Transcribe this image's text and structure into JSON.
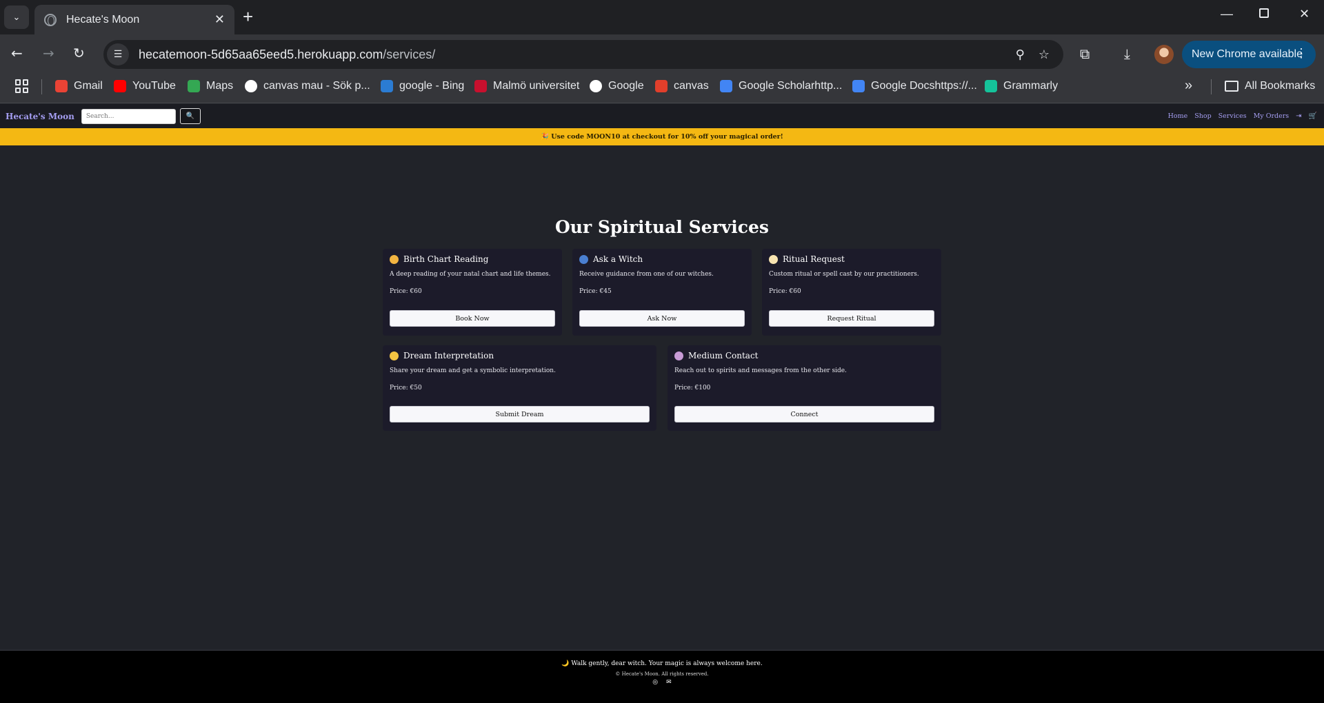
{
  "browser": {
    "tab_title": "Hecate's Moon",
    "tab_close": "✕",
    "new_tab": "+",
    "url_host": "hecatemoon-5d65aa65eed5.herokuapp.com",
    "url_path": "/services/",
    "update_button": "New Chrome available",
    "bookmarks": [
      {
        "label": "Gmail",
        "color": "#ea4335"
      },
      {
        "label": "YouTube",
        "color": "#ff0000"
      },
      {
        "label": "Maps",
        "color": "#34a853"
      },
      {
        "label": "canvas mau - Sök p...",
        "color": "#ffffff"
      },
      {
        "label": "google - Bing",
        "color": "#2b7cd3"
      },
      {
        "label": "Malmö universitet",
        "color": "#c8102e"
      },
      {
        "label": "Google",
        "color": "#ffffff"
      },
      {
        "label": "canvas",
        "color": "#e13f2b"
      },
      {
        "label": "Google Scholarhttp...",
        "color": "#4285f4"
      },
      {
        "label": "Google Docshttps://...",
        "color": "#4285f4"
      },
      {
        "label": "Grammarly",
        "color": "#15c39a"
      }
    ],
    "more_bookmarks": "»",
    "all_bookmarks": "All Bookmarks"
  },
  "site": {
    "brand": "Hecate's Moon",
    "search_placeholder": "Search...",
    "search_button_icon": "🔍",
    "nav": [
      "Home",
      "Shop",
      "Services",
      "My Orders"
    ],
    "logout_icon": "⇥",
    "cart_icon": "🛒",
    "promo": "🎉 Use code MOON10 at checkout for 10% off your magical order!"
  },
  "services": {
    "title": "Our Spiritual Services",
    "cards": [
      {
        "emoji_color": "#f2b441",
        "title": "Birth Chart Reading",
        "desc": "A deep reading of your natal chart and life themes.",
        "price": "Price: €60",
        "button": "Book Now"
      },
      {
        "emoji_color": "#4a7fd1",
        "title": "Ask a Witch",
        "desc": "Receive guidance from one of our witches.",
        "price": "Price: €45",
        "button": "Ask Now"
      },
      {
        "emoji_color": "#f7e3b0",
        "title": "Ritual Request",
        "desc": "Custom ritual or spell cast by our practitioners.",
        "price": "Price: €60",
        "button": "Request Ritual"
      },
      {
        "emoji_color": "#f4c542",
        "title": "Dream Interpretation",
        "desc": "Share your dream and get a symbolic interpretation.",
        "price": "Price: €50",
        "button": "Submit Dream"
      },
      {
        "emoji_color": "#c89bd6",
        "title": "Medium Contact",
        "desc": "Reach out to spirits and messages from the other side.",
        "price": "Price: €100",
        "button": "Connect"
      }
    ]
  },
  "footer": {
    "tagline": "🌙 Walk gently, dear witch. Your magic is always welcome here.",
    "copyright": "© Hecate's Moon. All rights reserved.",
    "instagram_icon": "◎",
    "email_icon": "✉"
  }
}
